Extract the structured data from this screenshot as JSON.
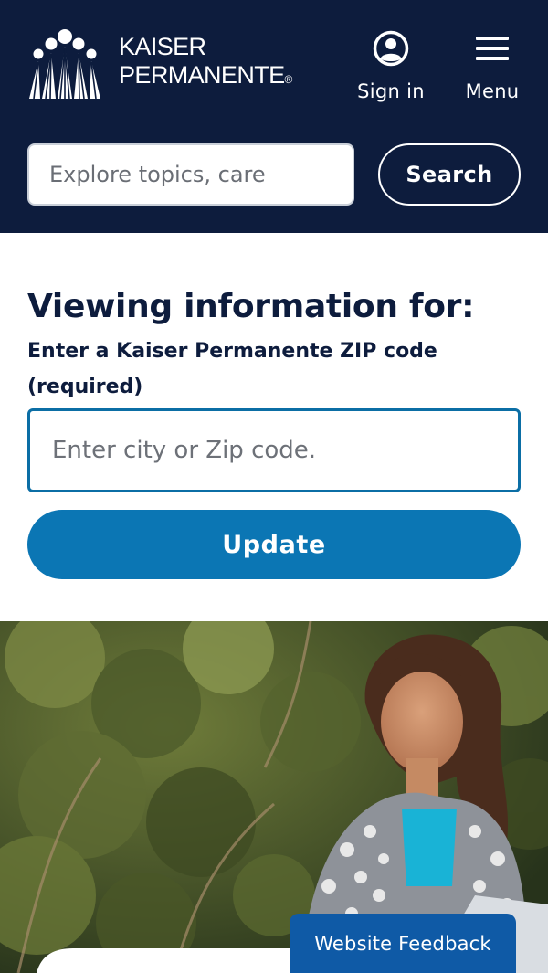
{
  "header": {
    "logo": {
      "line1": "KAISER",
      "line2": "PERMANENTE",
      "reg": "®"
    },
    "sign_in_label": "Sign in",
    "menu_label": "Menu",
    "search": {
      "placeholder": "Explore topics, care",
      "value": "",
      "button_label": "Search"
    }
  },
  "colors": {
    "header_bg": "#0d1c3d",
    "accent": "#0b76b4",
    "input_border": "#0b6ea5",
    "feedback_bg": "#0f5aa6"
  },
  "location": {
    "heading": "Viewing information for:",
    "zip_label": "Enter a Kaiser Permanente ZIP code (required)",
    "zip_placeholder": "Enter city or Zip code.",
    "zip_value": "",
    "update_label": "Update"
  },
  "hero": {
    "image": "woman-with-laptop-outdoors"
  },
  "feedback": {
    "label": "Website Feedback"
  },
  "icons": {
    "account": "user-circle-icon",
    "menu": "hamburger-menu-icon"
  }
}
